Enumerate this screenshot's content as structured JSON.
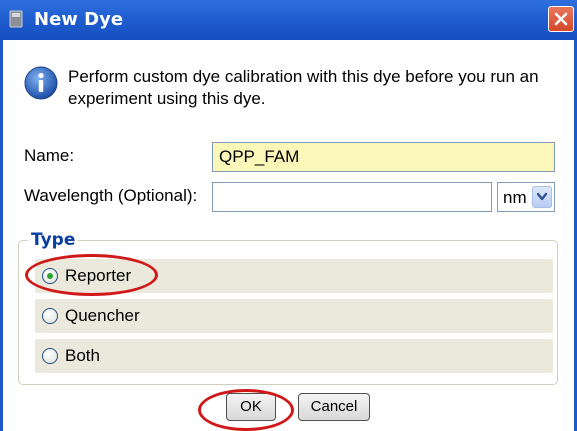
{
  "window": {
    "title": "New Dye"
  },
  "message": {
    "text": "Perform custom dye calibration with this dye before you run an experiment using this dye."
  },
  "form": {
    "name_label": "Name:",
    "name_value": "QPP_FAM",
    "wavelength_label": "Wavelength (Optional):",
    "wavelength_value": "",
    "unit_selected": "nm"
  },
  "type_group": {
    "legend": "Type",
    "options": [
      {
        "label": "Reporter",
        "selected": true
      },
      {
        "label": "Quencher",
        "selected": false
      },
      {
        "label": "Both",
        "selected": false
      }
    ]
  },
  "buttons": {
    "ok_label": "OK",
    "cancel_label": "Cancel"
  },
  "colors": {
    "titlebar": "#1e5ccf",
    "name_field_bg": "#fbf7b8",
    "legend_text": "#0a3fa0",
    "annotation_red": "#d01818",
    "radio_selected": "#2ea22e"
  },
  "icons": {
    "window": "window-icon",
    "close": "close-icon",
    "info": "info-icon",
    "dropdown": "chevron-down-icon"
  }
}
